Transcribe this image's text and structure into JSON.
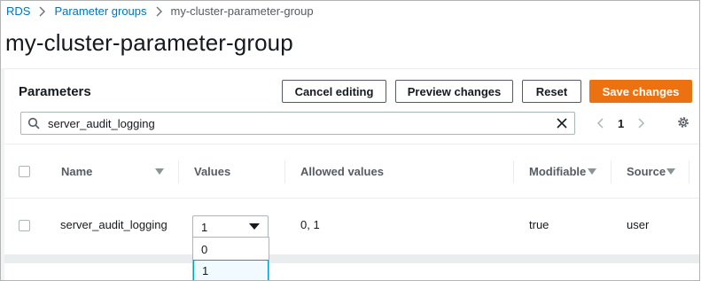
{
  "breadcrumb": {
    "items": [
      {
        "label": "RDS"
      },
      {
        "label": "Parameter groups"
      },
      {
        "label": "my-cluster-parameter-group"
      }
    ]
  },
  "page": {
    "title": "my-cluster-parameter-group"
  },
  "panel": {
    "title": "Parameters",
    "buttons": {
      "cancel": "Cancel editing",
      "preview": "Preview changes",
      "reset": "Reset",
      "save": "Save changes"
    },
    "search": {
      "value": "server_audit_logging",
      "icon": "search-icon",
      "clear_icon": "close-icon"
    },
    "pagination": {
      "current_page": "1"
    },
    "settings_icon": "gear-icon"
  },
  "table": {
    "columns": [
      "Name",
      "Values",
      "Allowed values",
      "Modifiable",
      "Source"
    ],
    "rows": [
      {
        "name": "server_audit_logging",
        "value": "1",
        "allowed_values": "0, 1",
        "modifiable": "true",
        "source": "user"
      }
    ]
  },
  "value_dropdown": {
    "options": [
      "0",
      "1"
    ],
    "selected": "1"
  },
  "colors": {
    "primary_button": "#ec7211",
    "link": "#0073bb",
    "selected_option_border": "#00a1c9"
  }
}
